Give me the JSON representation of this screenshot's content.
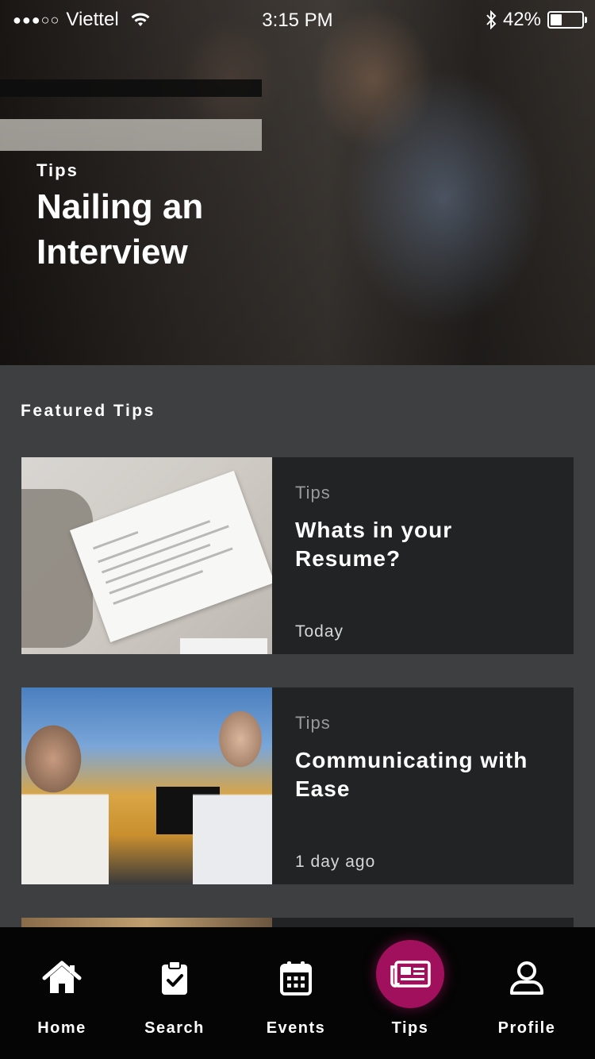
{
  "status_bar": {
    "signal_dots": "●●●○○",
    "carrier": "Viettel",
    "time": "3:15 PM",
    "battery_percent": "42%",
    "battery_level": 0.42
  },
  "hero": {
    "category": "Tips",
    "title": "Nailing an Interview"
  },
  "featured": {
    "section_title": "Featured Tips",
    "cards": [
      {
        "category": "Tips",
        "title": "Whats in your Resume?",
        "date": "Today"
      },
      {
        "category": "Tips",
        "title": "Communicating with Ease",
        "date": "1 day ago"
      }
    ]
  },
  "tabbar": {
    "active": "tips",
    "active_color": "#a0105c",
    "items": [
      {
        "id": "home",
        "label": "Home",
        "icon": "home-icon"
      },
      {
        "id": "search",
        "label": "Search",
        "icon": "clipboard-check-icon"
      },
      {
        "id": "events",
        "label": "Events",
        "icon": "calendar-icon"
      },
      {
        "id": "tips",
        "label": "Tips",
        "icon": "newspaper-icon"
      },
      {
        "id": "profile",
        "label": "Profile",
        "icon": "user-icon"
      }
    ]
  }
}
